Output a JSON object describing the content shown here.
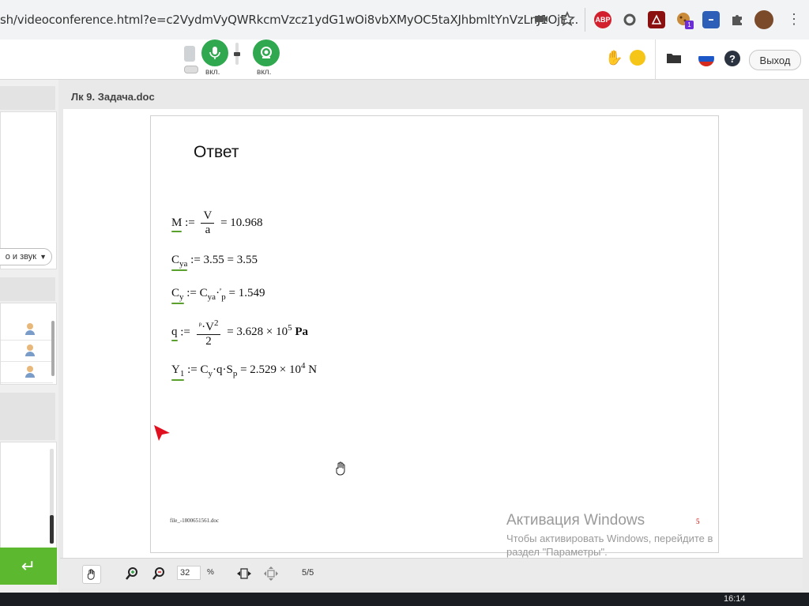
{
  "browser": {
    "url": "sh/videoconference.html?e=c2VydmVyQWRkcmVzcz1ydG1wOi8vbXMyOC5taXJhbmltYnVzLnJ1OjE...",
    "extensions": [
      "camera-icon",
      "star-icon",
      "adblock-icon",
      "circle-icon",
      "pdf-icon",
      "cookie-icon",
      "translate-icon",
      "puzzle-icon",
      "profile-avatar"
    ],
    "abp_label": "ABP",
    "badge_count": "1"
  },
  "toolbar": {
    "mic_state": "вкл.",
    "cam_state": "вкл.",
    "exit_label": "Выход"
  },
  "left_panel": {
    "device_select_value": "о и звук",
    "send_icon": "↵"
  },
  "document": {
    "title": "Лк 9. Задача.doc",
    "answer_heading": "Ответ",
    "formulas": [
      {
        "lhs": "M",
        "op": ":=",
        "expr_num": "V",
        "expr_den": "a",
        "result": "= 10.968"
      },
      {
        "lhs": "C",
        "lhs_sub": "ya",
        "op": ":=",
        "expr": "3.55",
        "result": "= 3.55"
      },
      {
        "lhs": "C",
        "lhs_sub": "y",
        "op": ":=",
        "expr": "C",
        "expr_sub": "ya",
        "expr_mid": "·",
        "expr_tiny": "ᵖ",
        "expr_tail": "p",
        "result": "= 1.549"
      },
      {
        "lhs": "q",
        "op": ":=",
        "expr_num_a": "ρ",
        "expr_num_b": "·V",
        "expr_num_sup": "2",
        "expr_den": "2",
        "result_a": "= 3.628 × 10",
        "result_sup": "5",
        "result_unit": "Pa"
      },
      {
        "lhs": "Y",
        "lhs_sub": "1",
        "op": ":=",
        "expr": "C",
        "expr_sub": "y",
        "expr_mid": "·q·S",
        "expr_sub2": "p",
        "result_a": "= 2.529 × 10",
        "result_sup": "4",
        "result_unit": "N"
      }
    ],
    "file_label": "file_-1800651561.doc",
    "page_mark": "5"
  },
  "windows_activation": {
    "title": "Активация Windows",
    "line2": "Чтобы активировать Windows, перейдите в",
    "line3": "раздел \"Параметры\"."
  },
  "doc_toolbar": {
    "zoom_value": "32",
    "zoom_unit": "%",
    "page_counter": "5/5"
  },
  "taskbar": {
    "clock": "16:14"
  },
  "colors": {
    "accent_green": "#2fa84f",
    "send_green": "#5cb82e",
    "underline_green": "#5aa02c",
    "pointer_red": "#e01020"
  }
}
